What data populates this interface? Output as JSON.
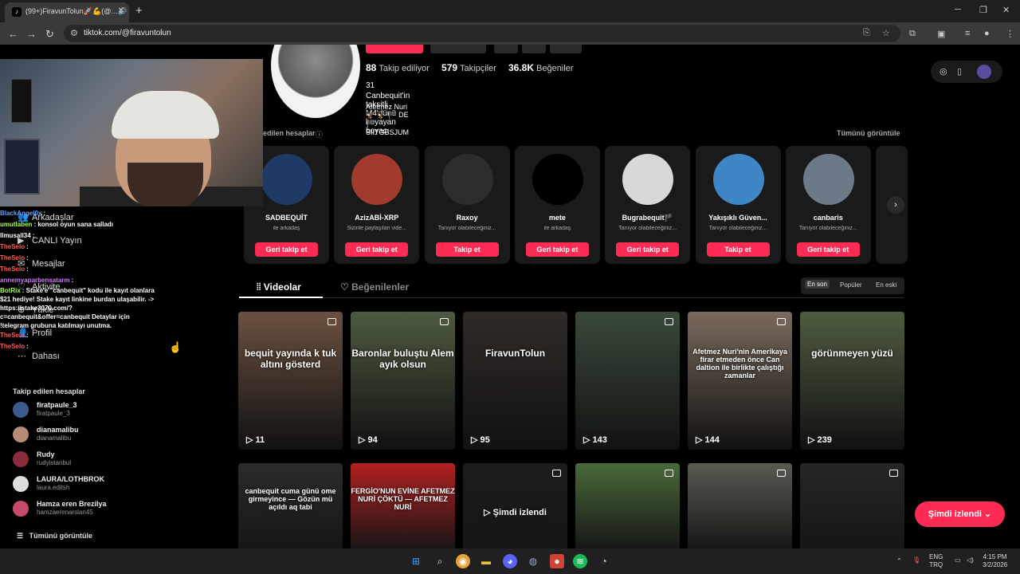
{
  "browser": {
    "tab_title": "(99+)FiravunTolun🚀💪(@…🔊",
    "url": "tiktok.com/@firavuntolun"
  },
  "profile": {
    "following_count": "88",
    "following_label": "Takip ediliyor",
    "followers_count": "579",
    "followers_label": "Takipçiler",
    "likes_count": "36.8K",
    "likes_label": "Beğeniler",
    "bio_line1": "31",
    "bio_line2": "Canbequit'in taksitli M4'dünü boyayan boyacı",
    "bio_line3": "Afetmez Nuri 🦅 🦅 🏴 DE 🏴 SIITGBSJUM"
  },
  "suggested": {
    "title": "edilen hesaplar",
    "see_all": "Tümünü görüntüle",
    "cards": [
      {
        "name": "SADBEQUİT",
        "sub": "ile arkadaş",
        "button": "Geri takip et",
        "avatar_color": "#1f3a66"
      },
      {
        "name": "AzizABİ-XRP",
        "sub": "Sizinle paylaşılan vide...",
        "button": "Geri takip et",
        "avatar_color": "#a33a2e"
      },
      {
        "name": "Raxoy",
        "sub": "Tanıyor olabileceğiniz...",
        "button": "Takip et",
        "avatar_color": "#2c2c2c"
      },
      {
        "name": "mete",
        "sub": "ile arkadaş",
        "button": "Geri takip et",
        "avatar_color": "#000000"
      },
      {
        "name": "Bugrabequit🏴",
        "sub": "Tanıyor olabileceğiniz...",
        "button": "Geri takip et",
        "avatar_color": "#d8d8d8"
      },
      {
        "name": "Yakışıklı Güven...",
        "sub": "Tanıyor olabileceğiniz...",
        "button": "Takip et",
        "avatar_color": "#3f86c6"
      },
      {
        "name": "canbaris",
        "sub": "Tanıyor olabileceğiniz...",
        "button": "Geri takip et",
        "avatar_color": "#6b7a86"
      }
    ]
  },
  "content_tabs": {
    "videos": "Videolar",
    "liked": "Beğenilenler",
    "sort_latest": "En son",
    "sort_popular": "Popüler",
    "sort_oldest": "En eski"
  },
  "videos_row1": [
    {
      "caption": "bequit yayında k tuk altını gösterd",
      "views": "11",
      "color": "#6b5040"
    },
    {
      "caption": "Baronlar buluştu Alem ayık olsun",
      "views": "94",
      "color": "#4d5a3f"
    },
    {
      "caption": "FiravunTolun",
      "views": "95",
      "color": "#2f2a28"
    },
    {
      "caption": "",
      "views": "143",
      "color": "#3a4a3a"
    },
    {
      "caption": "Afetmez Nuri'nin Amerikaya firar etmeden önce Can daltion ile birlikte çalıştığı zamanlar",
      "views": "144",
      "color": "#7a6a5c"
    },
    {
      "caption": "görünmeyen yüzü",
      "views": "239",
      "color": "#4f5c40"
    }
  ],
  "videos_row2": [
    {
      "caption": "canbequit cuma günü ome girmeyince — Gözün mü açıldı aq tabi",
      "color": "#2b2b2b"
    },
    {
      "caption": "FERGİO'NUN EVİNE AFETMEZ NURİ ÇÖKTÜ — AFETMEZ NURİ",
      "color": "#b32020"
    },
    {
      "caption": "",
      "color": "#1c1c1c"
    },
    {
      "caption": "",
      "color": "#4a6a3a"
    },
    {
      "caption": "",
      "color": "#5a5a52"
    },
    {
      "caption": "",
      "color": "#262626"
    }
  ],
  "now_watching": "Şimdi izlendi",
  "chat": [
    {
      "name": "BlackAngel0x",
      "text": ":",
      "color": "#6aa2ff"
    },
    {
      "name": "umutlaben",
      "text": ": konsol oyun sana salladı",
      "color": "#a8ff4f"
    },
    {
      "name": "llmusall34",
      "text": ":",
      "color": "#ffffff"
    },
    {
      "name": "TheSelo",
      "text": ":",
      "color": "#ff5a5a"
    },
    {
      "name": "TheSelo",
      "text": ":",
      "color": "#ff5a5a"
    },
    {
      "name": "TheSelo",
      "text": ":",
      "color": "#ff5a5a"
    },
    {
      "name": "annemyaparbensatarm",
      "text": ":",
      "color": "#d07cff"
    },
    {
      "name": "BotRix",
      "text": ": Stake'e \"canbequit\" kodu ile kayıt olanlara $21 hediye! Stake kayıt linkine burdan ulaşabilir. -> https://stake3070.com/?c=canbequit&offer=canbequit Detaylar için !telegram grubuna katılmayı unutma.",
      "color": "#a8ff4f"
    },
    {
      "name": "TheSelo",
      "text": ":",
      "color": "#ff5a5a"
    },
    {
      "name": "TheSelo",
      "text": ":",
      "color": "#ff5a5a"
    }
  ],
  "sidenav": {
    "items": [
      "Arkadaşlar",
      "CANLI Yayın",
      "Mesajlar",
      "Aktivite",
      "Yükle",
      "Profil",
      "Dahası"
    ]
  },
  "following": {
    "title": "Takip edilen hesaplar",
    "accounts": [
      {
        "name": "firatpaule_3",
        "user": "firatpaule_3",
        "color": "#3b5b8b"
      },
      {
        "name": "dianamalibu",
        "user": "dianamalibu",
        "color": "#b58a76"
      },
      {
        "name": "Rudy",
        "user": "rudyistanbul",
        "color": "#8b2c3b"
      },
      {
        "name": "LAURA/LOTHBROK",
        "user": "laura.editsh",
        "color": "#dddddd"
      },
      {
        "name": "Hamza eren Brezilya",
        "user": "hamzaerenarslan45",
        "color": "#c84a6a"
      }
    ],
    "see_all": "Tümünü görüntüle"
  },
  "taskbar": {
    "lang1": "ENG",
    "lang2": "TRQ",
    "time": "4:15 PM",
    "date": "3/2/2026"
  }
}
